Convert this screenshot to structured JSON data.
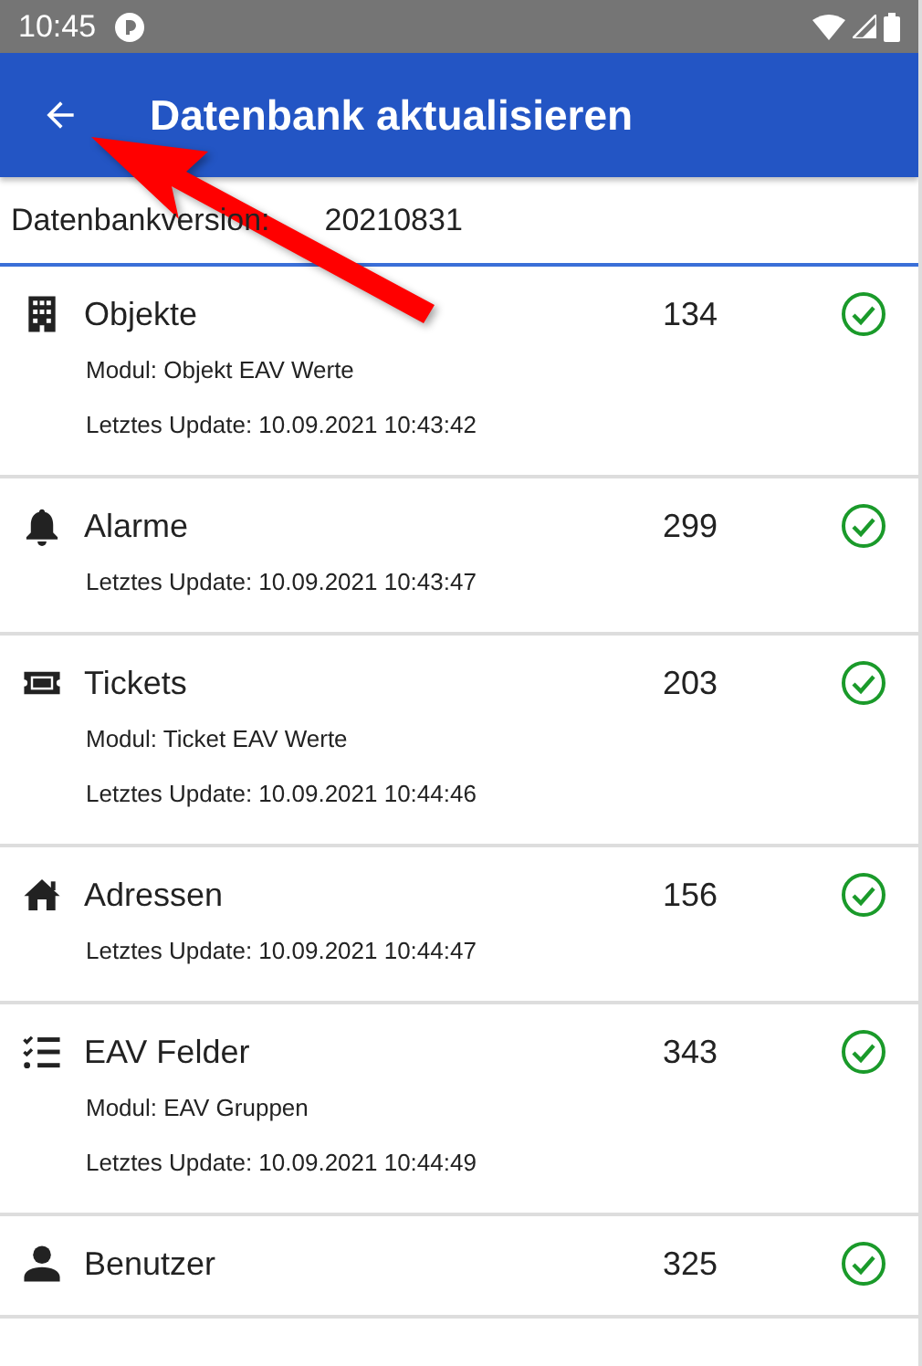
{
  "status_bar": {
    "time": "10:45"
  },
  "app_bar": {
    "title": "Datenbank aktualisieren"
  },
  "version": {
    "label": "Datenbankversion:",
    "value": "20210831"
  },
  "items": [
    {
      "kind": "building",
      "title": "Objekte",
      "count": "134",
      "module": "Modul: Objekt EAV Werte",
      "updated": "Letztes Update: 10.09.2021 10:43:42",
      "synced": true
    },
    {
      "kind": "bell",
      "title": "Alarme",
      "count": "299",
      "updated": "Letztes Update: 10.09.2021 10:43:47",
      "synced": true
    },
    {
      "kind": "ticket",
      "title": "Tickets",
      "count": "203",
      "module": "Modul: Ticket EAV Werte",
      "updated": "Letztes Update: 10.09.2021 10:44:46",
      "synced": true
    },
    {
      "kind": "home",
      "title": "Adressen",
      "count": "156",
      "updated": "Letztes Update: 10.09.2021 10:44:47",
      "synced": true
    },
    {
      "kind": "checklist",
      "title": "EAV Felder",
      "count": "343",
      "module": "Modul: EAV Gruppen",
      "updated": "Letztes Update: 10.09.2021 10:44:49",
      "synced": true
    },
    {
      "kind": "person",
      "title": "Benutzer",
      "count": "325",
      "synced": true
    }
  ]
}
